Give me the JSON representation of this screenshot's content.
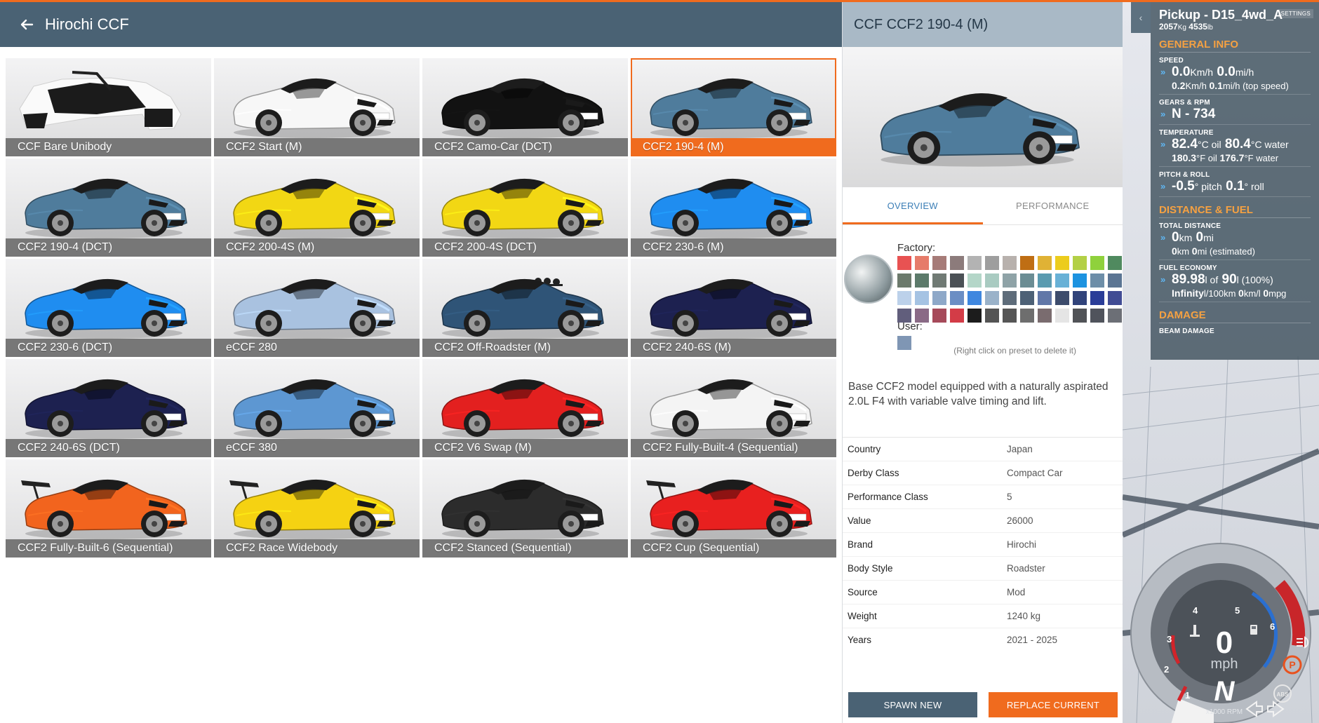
{
  "header": {
    "title": "Hirochi CCF"
  },
  "cards": [
    {
      "label": "CCF Bare Unibody",
      "color": "#ffffff",
      "style": "frame"
    },
    {
      "label": "CCF2 Start (M)",
      "color": "#f7f7f7",
      "style": "car"
    },
    {
      "label": "CCF2 Camo-Car (DCT)",
      "color": "#121212",
      "style": "car"
    },
    {
      "label": "CCF2 190-4 (M)",
      "color": "#4f7c9c",
      "style": "car",
      "selected": true
    },
    {
      "label": "CCF2 190-4 (DCT)",
      "color": "#4f7c9c",
      "style": "car"
    },
    {
      "label": "CCF2 200-4S (M)",
      "color": "#f2d714",
      "style": "car"
    },
    {
      "label": "CCF2 200-4S (DCT)",
      "color": "#f2d714",
      "style": "car"
    },
    {
      "label": "CCF2 230-6 (M)",
      "color": "#1f8df0",
      "style": "car"
    },
    {
      "label": "CCF2 230-6 (DCT)",
      "color": "#1f8df0",
      "style": "car"
    },
    {
      "label": "eCCF 280",
      "color": "#a9c2e0",
      "style": "car"
    },
    {
      "label": "CCF2 Off-Roadster (M)",
      "color": "#2f5477",
      "style": "offroad"
    },
    {
      "label": "CCF2 240-6S (M)",
      "color": "#1d2150",
      "style": "car"
    },
    {
      "label": "CCF2 240-6S (DCT)",
      "color": "#1d2150",
      "style": "car"
    },
    {
      "label": "eCCF 380",
      "color": "#5d97d2",
      "style": "car"
    },
    {
      "label": "CCF2 V6 Swap (M)",
      "color": "#e3201f",
      "style": "car"
    },
    {
      "label": "CCF2 Fully-Built-4 (Sequential)",
      "color": "#f4f4f4",
      "style": "car"
    },
    {
      "label": "CCF2 Fully-Built-6 (Sequential)",
      "color": "#f2641e",
      "style": "wing"
    },
    {
      "label": "CCF2 Race Widebody",
      "color": "#f5d212",
      "style": "wing"
    },
    {
      "label": "CCF2 Stanced (Sequential)",
      "color": "#2c2c2c",
      "style": "car"
    },
    {
      "label": "CCF2 Cup (Sequential)",
      "color": "#e8201f",
      "style": "wing"
    }
  ],
  "detail": {
    "title": "CCF CCF2 190-4 (M)",
    "car_color": "#4f7c9c",
    "tabs": [
      "OVERVIEW",
      "PERFORMANCE"
    ],
    "factory_label": "Factory:",
    "user_label": "User:",
    "hint": "(Right click on preset to delete it)",
    "swatches": [
      "#e85252",
      "#e67b6a",
      "#a67b78",
      "#8c7b7b",
      "#b3b3b3",
      "#9e9e9e",
      "#b8b1ad",
      "#bf6e14",
      "#e0b235",
      "#eccc1c",
      "#b3d046",
      "#8fd13c",
      "#508a5f",
      "#6c7a6c",
      "#5c7a6a",
      "#707a74",
      "#4b5156",
      "#b4d6c8",
      "#a9cbc1",
      "#8fa3a7",
      "#6b8d94",
      "#5a9bb0",
      "#68b1d6",
      "#1d93e0",
      "#6d8ea8",
      "#5b7593",
      "#bcd1ea",
      "#a5c3e3",
      "#8ea8c8",
      "#6b8ec4",
      "#3f87df",
      "#9ab2c9",
      "#5e6c7a",
      "#4d6176",
      "#6177a8",
      "#3d4c6c",
      "#30437a",
      "#2a3d98",
      "#414c94",
      "#615e7c",
      "#8a6a86",
      "#a64a5a",
      "#d33c47",
      "#1c1c1c",
      "#545454",
      "#565656",
      "#6e6e6e",
      "#7a6c6f",
      "#e5e5e5",
      "#515357",
      "#50535c",
      "#6c6f76"
    ],
    "description": "Base CCF2 model equipped with a naturally aspirated 2.0L F4 with variable valve timing and lift.",
    "info": [
      {
        "key": "Country",
        "value": "Japan"
      },
      {
        "key": "Derby Class",
        "value": "Compact Car"
      },
      {
        "key": "Performance Class",
        "value": "5"
      },
      {
        "key": "Value",
        "value": "26000"
      },
      {
        "key": "Brand",
        "value": "Hirochi"
      },
      {
        "key": "Body Style",
        "value": "Roadster"
      },
      {
        "key": "Source",
        "value": "Mod"
      },
      {
        "key": "Weight",
        "value": "1240 kg"
      },
      {
        "key": "Years",
        "value": "2021 - 2025"
      }
    ],
    "spawn_label": "SPAWN NEW",
    "replace_label": "REPLACE CURRENT"
  },
  "hud": {
    "title": "Pickup - D15_4wd_A",
    "mass_kg": "2057",
    "mass_kg_unit": "Kg",
    "mass_lb": "4535",
    "mass_lb_unit": "lb",
    "settings": "SETTINGS",
    "general_info": "GENERAL INFO",
    "speed_label": "SPEED",
    "speed_kmh": "0.0",
    "speed_kmh_unit": "Km/h",
    "speed_mph": "0.0",
    "speed_mph_unit": "mi/h",
    "top_kmh": "0.2",
    "top_kmh_unit": "Km/h",
    "top_mph": "0.1",
    "top_mph_unit": "mi/h (top speed)",
    "gears_label": "GEARS & RPM",
    "gears_value": "N - 734",
    "temp_label": "TEMPERATURE",
    "temp_oil_c": "82.4",
    "temp_oil_c_unit": "°C oil",
    "temp_water_c": "80.4",
    "temp_water_c_unit": "°C water",
    "temp_oil_f": "180.3",
    "temp_oil_f_unit": "°F oil",
    "temp_water_f": "176.7",
    "temp_water_f_unit": "°F water",
    "pitch_label": "PITCH & ROLL",
    "pitch": "-0.5",
    "pitch_unit": "° pitch",
    "roll": "0.1",
    "roll_unit": "° roll",
    "distance_fuel": "DISTANCE & FUEL",
    "total_distance_label": "TOTAL DISTANCE",
    "dist_km": "0",
    "dist_km_unit": "km",
    "dist_mi": "0",
    "dist_mi_unit": "mi",
    "est_km": "0",
    "est_km_unit": "km",
    "est_mi": "0",
    "est_mi_unit": "mi (estimated)",
    "fuel_economy_label": "FUEL ECONOMY",
    "fuel_amount": "89.98",
    "fuel_of": "l of",
    "fuel_cap": "90",
    "fuel_pct": "l (100%)",
    "econ_inf": "Infinity",
    "econ_inf_unit": "l/100km",
    "econ_kml": "0",
    "econ_kml_unit": "km/l",
    "econ_mpg": "0",
    "econ_mpg_unit": "mpg",
    "damage": "DAMAGE",
    "beam_damage_label": "BEAM DAMAGE"
  },
  "gauge": {
    "speed": "0",
    "unit": "mph",
    "gear": "N",
    "rpm_label": "x1000 RPM",
    "ticks": [
      "1",
      "2",
      "3",
      "4",
      "5",
      "6"
    ],
    "abs": "ABS",
    "park": "P"
  }
}
